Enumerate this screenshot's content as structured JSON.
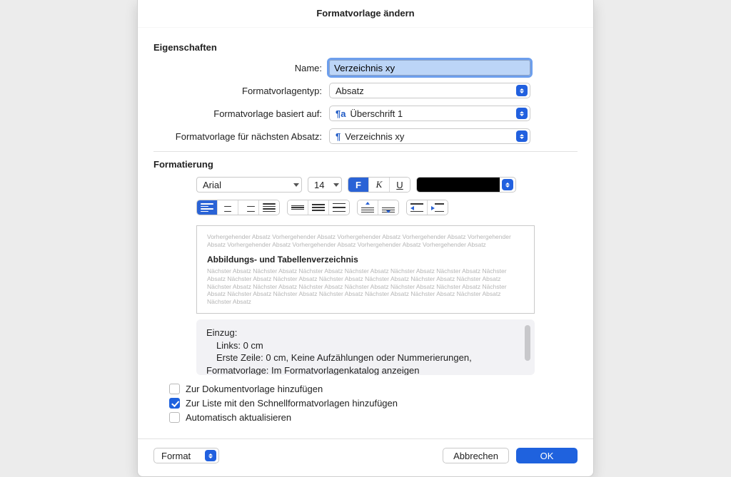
{
  "dialog": {
    "title": "Formatvorlage ändern"
  },
  "properties": {
    "section_label": "Eigenschaften",
    "name_label": "Name:",
    "name_value": "Verzeichnis xy",
    "type_label": "Formatvorlagentyp:",
    "type_value": "Absatz",
    "basedon_label": "Formatvorlage basiert auf:",
    "basedon_value": "Überschrift 1",
    "nextpara_label": "Formatvorlage für nächsten Absatz:",
    "nextpara_value": "Verzeichnis xy"
  },
  "formatting": {
    "section_label": "Formatierung",
    "font_name": "Arial",
    "font_size": "14",
    "bold_label": "F",
    "italic_label": "K",
    "underline_label": "U",
    "color": "#000000"
  },
  "preview": {
    "prev_text": "Vorhergehender Absatz Vorhergehender Absatz Vorhergehender Absatz Vorhergehender Absatz Vorhergehender Absatz Vorhergehender Absatz Vorhergehender Absatz Vorhergehender Absatz Vorhergehender Absatz",
    "sample_text": "Abbildungs- und Tabellenverzeichnis",
    "next_text": "Nächster Absatz Nächster Absatz Nächster Absatz Nächster Absatz Nächster Absatz Nächster Absatz Nächster Absatz Nächster Absatz Nächster Absatz Nächster Absatz Nächster Absatz Nächster Absatz Nächster Absatz Nächster Absatz Nächster Absatz Nächster Absatz Nächster Absatz Nächster Absatz Nächster Absatz Nächster Absatz Nächster Absatz Nächster Absatz Nächster Absatz Nächster Absatz Nächster Absatz Nächster Absatz Nächster Absatz"
  },
  "description": {
    "line1": "Einzug:",
    "line2": "Links:  0 cm",
    "line3": "Erste Zeile:  0 cm,  Keine Aufzählungen oder Nummerierungen,",
    "line4": "Formatvorlage: Im Formatvorlagenkatalog anzeigen"
  },
  "checks": {
    "add_template": {
      "label": "Zur Dokumentvorlage hinzufügen",
      "checked": false
    },
    "add_quick": {
      "label": "Zur Liste mit den Schnellformatvorlagen hinzufügen",
      "checked": true
    },
    "auto_update": {
      "label": "Automatisch aktualisieren",
      "checked": false
    }
  },
  "footer": {
    "format_label": "Format",
    "cancel_label": "Abbrechen",
    "ok_label": "OK"
  }
}
